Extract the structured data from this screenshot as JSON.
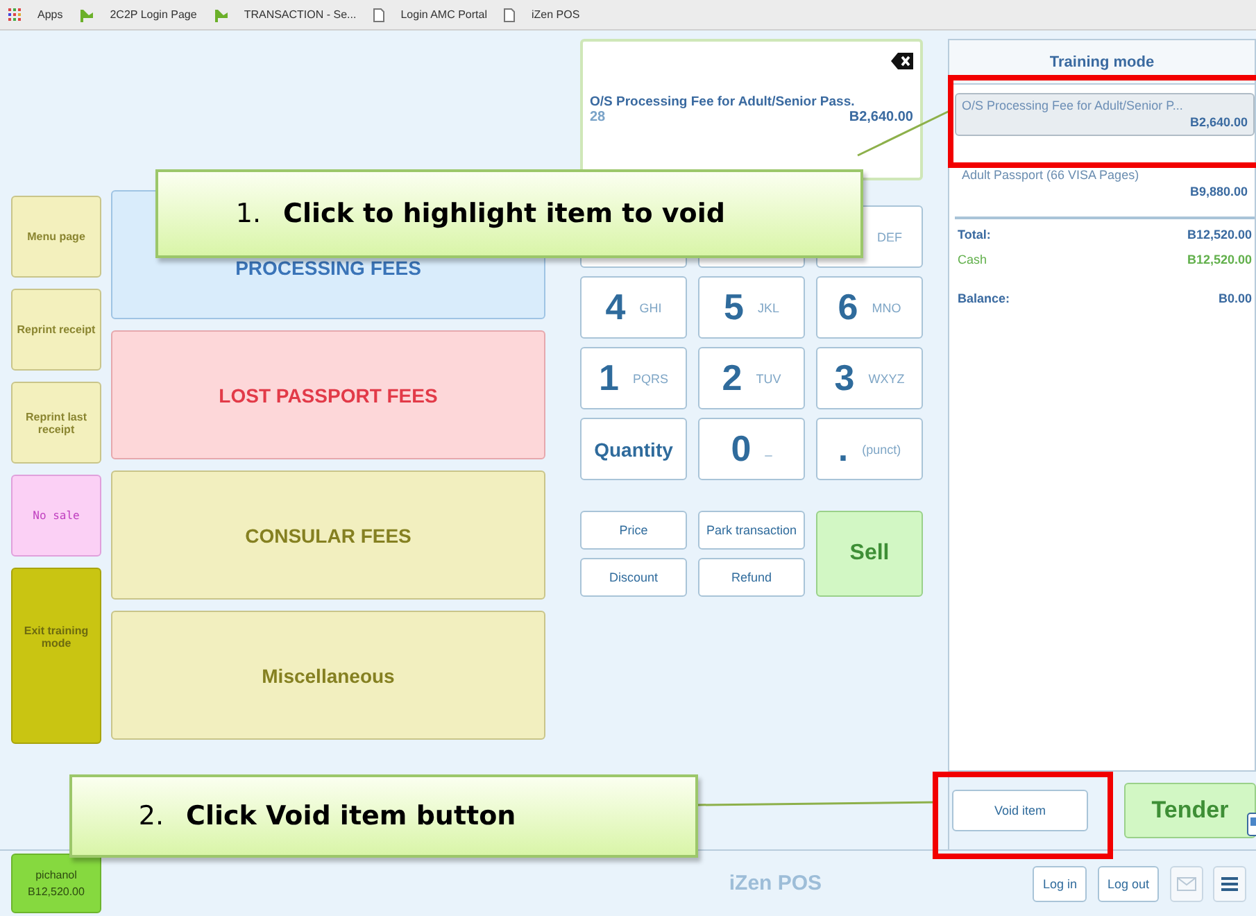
{
  "bookmarks": [
    {
      "kind": "apps",
      "label": "Apps"
    },
    {
      "kind": "site",
      "label": "2C2P Login Page"
    },
    {
      "kind": "site",
      "label": "TRANSACTION - Se..."
    },
    {
      "kind": "page",
      "label": "Login AMC Portal"
    },
    {
      "kind": "page",
      "label": "iZen POS"
    }
  ],
  "side_buttons": [
    {
      "kind": "plain",
      "label": "Menu page"
    },
    {
      "kind": "plain",
      "label": "Reprint receipt"
    },
    {
      "kind": "plain",
      "label": "Reprint last receipt"
    },
    {
      "kind": "nosale",
      "label": "No sale"
    },
    {
      "kind": "exit",
      "label": "Exit training mode"
    }
  ],
  "categories": [
    {
      "kind": "blue",
      "label": "PROCESSING FEES"
    },
    {
      "kind": "red",
      "label": "LOST PASSPORT FEES"
    },
    {
      "kind": "yellow",
      "label": "CONSULAR FEES"
    },
    {
      "kind": "yellow",
      "label": "Miscellaneous"
    }
  ],
  "display": {
    "item": "O/S Processing Fee for Adult/Senior Pass.",
    "quantity": "28",
    "price": "B2,640.00"
  },
  "keypad": [
    {
      "kind": "digit"
    },
    {
      "kind": "digit"
    },
    {
      "kind": "digit",
      "sub": "DEF"
    },
    {
      "kind": "digit",
      "main": "4",
      "sub": "GHI"
    },
    {
      "kind": "digit",
      "main": "5",
      "sub": "JKL"
    },
    {
      "kind": "digit",
      "main": "6",
      "sub": "MNO"
    },
    {
      "kind": "digit",
      "main": "1",
      "sub": "PQRS"
    },
    {
      "kind": "digit",
      "main": "2",
      "sub": "TUV"
    },
    {
      "kind": "digit",
      "main": "3",
      "sub": "WXYZ"
    },
    {
      "kind": "word",
      "main": "Quantity"
    },
    {
      "kind": "digit",
      "main": "0",
      "sub": "_"
    },
    {
      "kind": "digit",
      "main": ".",
      "sub": "(punct)"
    }
  ],
  "actions": [
    "Price",
    "Park transaction",
    "Discount",
    "Refund"
  ],
  "sell": "Sell",
  "receipt": {
    "title": "Training mode",
    "items": [
      {
        "name": "O/S Processing Fee for Adult/Senior P...",
        "price": "B2,640.00",
        "selected": true
      },
      {
        "name": "Adult Passport (66 VISA Pages)",
        "price": "B9,880.00",
        "selected": false
      }
    ],
    "totals": [
      {
        "kind": "total",
        "label": "Total:",
        "value": "B12,520.00"
      },
      {
        "kind": "cash",
        "label": "Cash",
        "value": "B12,520.00"
      },
      {
        "kind": "balance",
        "label": "Balance:",
        "value": "B0.00"
      }
    ]
  },
  "void_button": "Void item",
  "tender_button": "Tender",
  "footer": {
    "user": "pichanol",
    "amount": "B12,520.00",
    "app_name": "iZen POS",
    "buttons": [
      "Log in",
      "Log out"
    ]
  },
  "callouts": [
    {
      "number": "1.",
      "text": "Click to highlight item to void"
    },
    {
      "number": "2.",
      "text": "Click Void item button"
    }
  ]
}
